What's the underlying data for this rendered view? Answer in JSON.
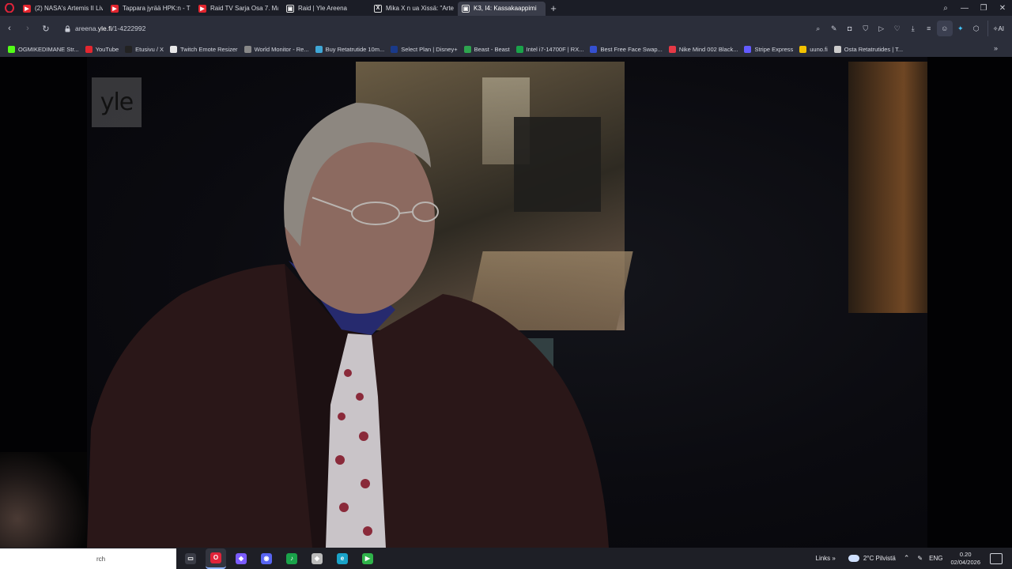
{
  "browser": {
    "tabs": [
      {
        "label": "(2) NASA's Artemis II Live",
        "icon": "youtube-icon",
        "color": "#e3262f",
        "active": false
      },
      {
        "label": "Tappara jyrää HPK:n - Tät",
        "icon": "youtube-icon",
        "color": "#e3262f",
        "active": false
      },
      {
        "label": "Raid TV Sarja Osa 7. Marat",
        "icon": "youtube-icon",
        "color": "#e3262f",
        "active": false
      },
      {
        "label": "Raid | Yle Areena",
        "icon": "yle-areena-icon",
        "color": "#ffffff",
        "active": false
      },
      {
        "label": "Mika X n ua Xissä: \"Artem",
        "icon": "x-icon",
        "color": "#ffffff",
        "active": false
      },
      {
        "label": "K3, I4: Kassakaappimi",
        "icon": "yle-areena-icon",
        "color": "#ffffff",
        "active": true
      }
    ],
    "url": {
      "prefix": "areena.",
      "domain": "yle.fi",
      "path": "/1-4222992"
    },
    "ai_label": "AI",
    "bookmarks": [
      {
        "label": "OGMIKEDIMANE Str...",
        "icon": "kick-icon",
        "color": "#53fc18"
      },
      {
        "label": "YouTube",
        "icon": "youtube-icon",
        "color": "#e3262f"
      },
      {
        "label": "Etusivu / X",
        "icon": "x-icon",
        "color": "#222222"
      },
      {
        "label": "Twitch Emote Resizer",
        "icon": "page-icon",
        "color": "#e8e8e8"
      },
      {
        "label": "World Monitor - Re...",
        "icon": "monitor-icon",
        "color": "#888888"
      },
      {
        "label": "Buy Retatrutide 10m...",
        "icon": "globe-icon",
        "color": "#3fa7d6"
      },
      {
        "label": "Select Plan | Disney+",
        "icon": "disney-icon",
        "color": "#1a3a8a"
      },
      {
        "label": "Beast - Beast",
        "icon": "beast-icon",
        "color": "#2ea44f"
      },
      {
        "label": "Intel i7-14700F | RX...",
        "icon": "intel-icon",
        "color": "#1aa34a"
      },
      {
        "label": "Best Free Face Swap...",
        "icon": "swap-icon",
        "color": "#3550d0"
      },
      {
        "label": "Nike Mind 002 Black...",
        "icon": "nike-icon",
        "color": "#e63946"
      },
      {
        "label": "Stripe Express",
        "icon": "stripe-icon",
        "color": "#635bff"
      },
      {
        "label": "uuno.fi",
        "icon": "uuno-icon",
        "color": "#f2c200"
      },
      {
        "label": "Osta Retatrutides | T...",
        "icon": "bottle-icon",
        "color": "#cccccc"
      }
    ]
  },
  "video": {
    "channel_logo": "yle"
  },
  "taskbar": {
    "search_placeholder": "rch",
    "apps": [
      {
        "name": "task-view-icon",
        "glyph": "▭",
        "color": "#3a3c46"
      },
      {
        "name": "opera-gx-icon",
        "glyph": "O",
        "color": "#e0243a"
      },
      {
        "name": "copilot-icon",
        "glyph": "◆",
        "color": "#7b5cff"
      },
      {
        "name": "discord-icon",
        "glyph": "◉",
        "color": "#5865f2"
      },
      {
        "name": "spotify-ish-icon",
        "glyph": "♪",
        "color": "#1aa34a"
      },
      {
        "name": "shield-icon",
        "glyph": "◈",
        "color": "#bbbbbb"
      },
      {
        "name": "edge-icon",
        "glyph": "e",
        "color": "#1aa3c8"
      },
      {
        "name": "play-store-icon",
        "glyph": "▶",
        "color": "#2fb34a"
      }
    ],
    "links_label": "Links",
    "weather": "2°C Pilvistä",
    "language": "ENG",
    "time": "0.20",
    "date": "02/04/2026"
  }
}
